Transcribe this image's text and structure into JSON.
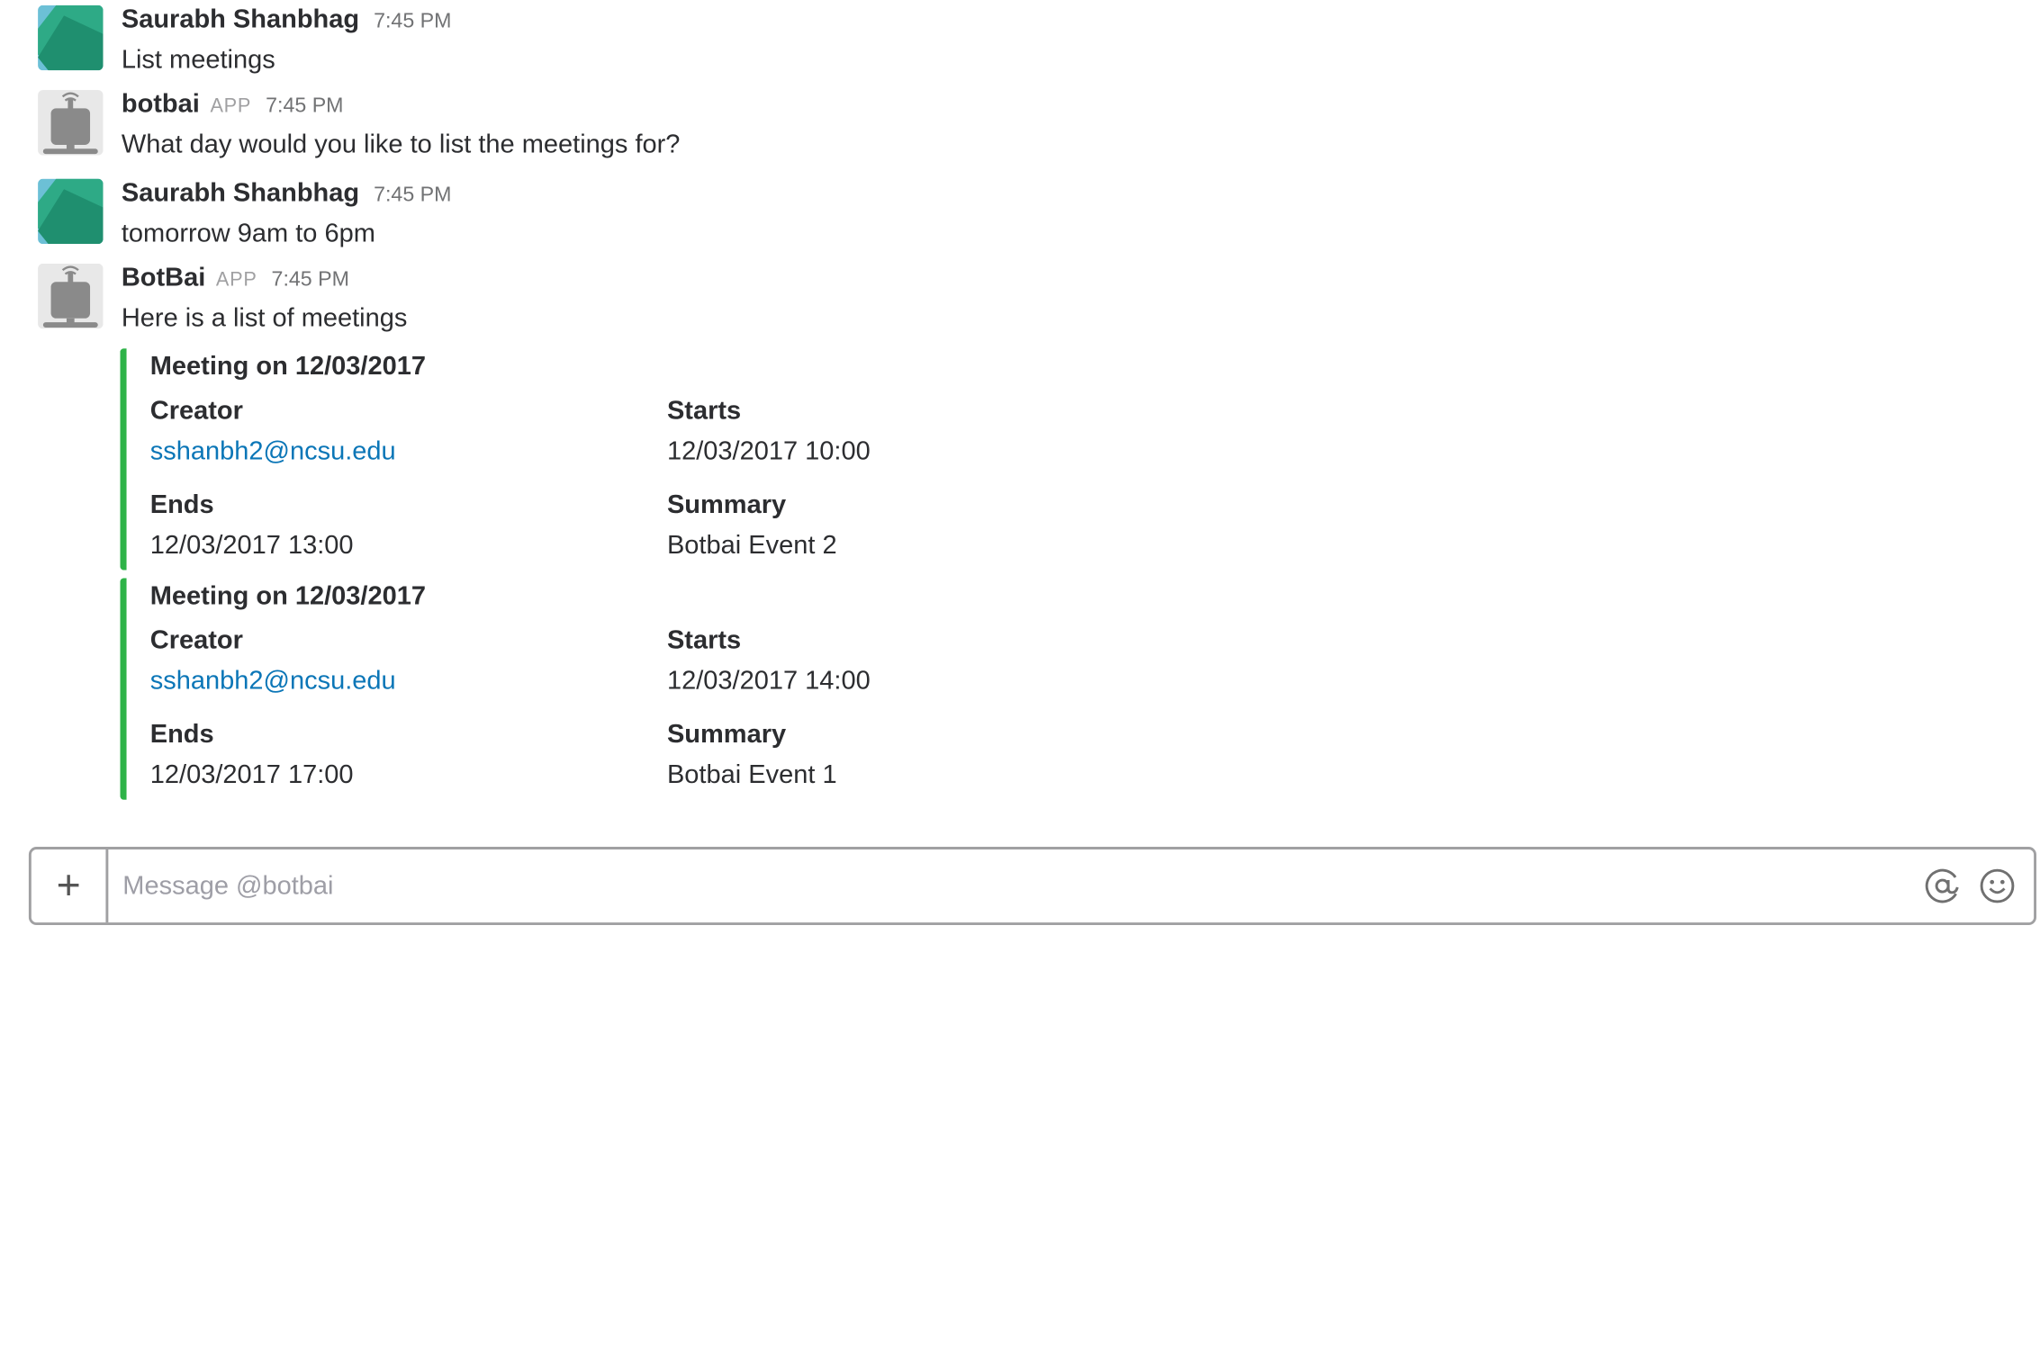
{
  "messages": [
    {
      "sender": "Saurabh Shanbhag",
      "app_badge": "",
      "time": "7:45 PM",
      "text": "List meetings",
      "avatar": "user-avatar"
    },
    {
      "sender": "botbai",
      "app_badge": "APP",
      "time": "7:45 PM",
      "text": "What day would you like to list the meetings for?",
      "avatar": "bot-avatar"
    },
    {
      "sender": "Saurabh Shanbhag",
      "app_badge": "",
      "time": "7:45 PM",
      "text": "tomorrow 9am to 6pm",
      "avatar": "user-avatar"
    },
    {
      "sender": "BotBai",
      "app_badge": "APP",
      "time": "7:45 PM",
      "text": "Here is a list of meetings",
      "avatar": "bot-avatar"
    }
  ],
  "attachments": [
    {
      "title": "Meeting on 12/03/2017",
      "creator_label": "Creator",
      "creator_value": "sshanbh2@ncsu.edu",
      "starts_label": "Starts",
      "starts_value": "12/03/2017 10:00",
      "ends_label": "Ends",
      "ends_value": "12/03/2017 13:00",
      "summary_label": "Summary",
      "summary_value": "Botbai Event 2"
    },
    {
      "title": "Meeting on 12/03/2017",
      "creator_label": "Creator",
      "creator_value": "sshanbh2@ncsu.edu",
      "starts_label": "Starts",
      "starts_value": "12/03/2017 14:00",
      "ends_label": "Ends",
      "ends_value": "12/03/2017 17:00",
      "summary_label": "Summary",
      "summary_value": "Botbai Event 1"
    }
  ],
  "composer": {
    "placeholder": "Message @botbai",
    "plus_label": "+",
    "icons": [
      "plus-icon",
      "at-icon",
      "emoji-icon"
    ]
  },
  "colors": {
    "attachment_bar": "#2eb348",
    "link": "#0b76b7",
    "text": "#2c2d30",
    "muted": "#717274"
  }
}
